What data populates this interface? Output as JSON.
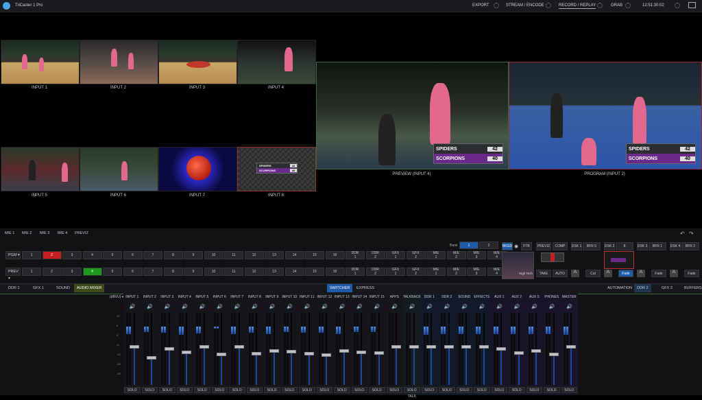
{
  "app": {
    "title": "TriCaster 1 Pro"
  },
  "topbar": {
    "export": "EXPORT",
    "stream": "STREAM / ENCODE",
    "record": "RECORD / REPLAY",
    "grab": "GRAB",
    "time": "12:51:30:02"
  },
  "monitors": {
    "inputs": [
      "INPUT 1",
      "INPUT 2",
      "INPUT 3",
      "INPUT 4",
      "INPUT 5",
      "INPUT 6",
      "INPUT 7",
      "INPUT 8"
    ],
    "preview": "PREVIEW (INPUT 4)",
    "program": "PROGRAM (INPUT 2)"
  },
  "scoreboard": {
    "team1": "SPIDERS",
    "score1": "42",
    "team2": "SCORPIONS",
    "score2": "40"
  },
  "me_tabs": [
    "M/E 1",
    "M/E 2",
    "M/E 3",
    "M/E 4",
    "PREVIZ"
  ],
  "switcher": {
    "bank_label": "Bank",
    "bank_buttons": [
      "1",
      "2"
    ],
    "pgm_label": "PGM ▾",
    "prev_label": "PREV ▾",
    "numbers": [
      "1",
      "2",
      "3",
      "4",
      "5",
      "6",
      "7",
      "8",
      "9",
      "10",
      "11",
      "12",
      "13",
      "14",
      "15",
      "16"
    ],
    "sources": [
      "DDR\n1",
      "DDR\n2",
      "GFX\n1",
      "GFX\n2",
      "M/E\n1",
      "M/E\n2",
      "M/E\n3",
      "M/E\n4"
    ],
    "bkgd": "BKGD",
    "ftb": "FTB",
    "previz": "PREVIZ",
    "comp": "COMP",
    "dsk1": "DSK 1",
    "bfr5": "BFR 5",
    "dsk2": "DSK 2",
    "dsk2v": "8",
    "dsk3": "DSK 3",
    "bfr1": "BFR 1",
    "dsk4": "DSK 4",
    "bfr2": "BFR 2",
    "take": "TAKE",
    "auto": "AUTO",
    "cut": "Cut",
    "fade": "Fade",
    "hightech": "High Tech"
  },
  "mid_tabs": {
    "ddr1": "DDR 1",
    "gfx1": "GFX 1",
    "sound": "SOUND",
    "audio_mixer": "AUDIO MIXER",
    "switcher": "SWITCHER",
    "express": "EXPRESS",
    "automation": "AUTOMATION",
    "ddr2": "DDR 2",
    "gfx2": "GFX 2",
    "buffers": "BUFFERS"
  },
  "mixer": {
    "dbvu": "(dBVU) ▾",
    "scale": [
      "12",
      "6",
      "0",
      "-6",
      "-12",
      "-20",
      "-40"
    ],
    "channels": [
      {
        "name": "INPUT 1",
        "level": 0.35,
        "fader": 0.55,
        "solo": "SOLO"
      },
      {
        "name": "INPUT 2",
        "level": 0.28,
        "fader": 0.4,
        "solo": "SOLO"
      },
      {
        "name": "INPUT 3",
        "level": 0.3,
        "fader": 0.52,
        "solo": "SOLO"
      },
      {
        "name": "INPUT 4",
        "level": 0.4,
        "fader": 0.48,
        "solo": "SOLO"
      },
      {
        "name": "INPUT 5",
        "level": 0.32,
        "fader": 0.55,
        "solo": "SOLO"
      },
      {
        "name": "INPUT 6",
        "level": 0.1,
        "fader": 0.45,
        "solo": "SOLO"
      },
      {
        "name": "INPUT 7",
        "level": 0.36,
        "fader": 0.55,
        "solo": "SOLO"
      },
      {
        "name": "INPUT 8",
        "level": 0.3,
        "fader": 0.46,
        "solo": "SOLO"
      },
      {
        "name": "INPUT 9",
        "level": 0.35,
        "fader": 0.5,
        "solo": "SOLO"
      },
      {
        "name": "INPUT 10",
        "level": 0.28,
        "fader": 0.49,
        "solo": "SOLO"
      },
      {
        "name": "INPUT 11",
        "level": 0.3,
        "fader": 0.46,
        "solo": "SOLO"
      },
      {
        "name": "INPUT 12",
        "level": 0.3,
        "fader": 0.44,
        "solo": "SOLO"
      },
      {
        "name": "INPUT 13",
        "level": 0.35,
        "fader": 0.5,
        "solo": "SOLO"
      },
      {
        "name": "INPUT 14",
        "level": 0.28,
        "fader": 0.48,
        "solo": "SOLO"
      },
      {
        "name": "INPUT 15",
        "level": 0.28,
        "fader": 0.47,
        "solo": "SOLO"
      },
      {
        "name": "APPS",
        "level": 0.0,
        "fader": 0.55,
        "solo": "SOLO"
      },
      {
        "name": "TALKBACK",
        "level": 0.0,
        "fader": 0.55,
        "solo": "SOLO TALK"
      },
      {
        "name": "DDR 1",
        "level": 0.4,
        "fader": 0.55,
        "solo": "SOLO"
      },
      {
        "name": "DDR 2",
        "level": 0.38,
        "fader": 0.55,
        "solo": "SOLO"
      },
      {
        "name": "SOUND",
        "level": 0.38,
        "fader": 0.55,
        "solo": "SOLO"
      },
      {
        "name": "EFFECTS",
        "level": 0.36,
        "fader": 0.55,
        "solo": "SOLO"
      },
      {
        "name": "AUX 1",
        "level": 0.38,
        "fader": 0.52,
        "solo": "SOLO"
      },
      {
        "name": "AUX 2",
        "level": 0.36,
        "fader": 0.47,
        "solo": "SOLO"
      },
      {
        "name": "AUX 3",
        "level": 0.38,
        "fader": 0.5,
        "solo": "SOLO"
      },
      {
        "name": "PHONES",
        "level": 0.36,
        "fader": 0.45,
        "solo": "SOLO"
      },
      {
        "name": "MASTER",
        "level": 0.4,
        "fader": 0.55,
        "solo": "SOLO"
      }
    ]
  },
  "colors": {
    "accent": "#1f5aa6",
    "pgm": "#c41e1e",
    "prev": "#1e9a1e",
    "audio_tab": "#3d4a1c"
  }
}
